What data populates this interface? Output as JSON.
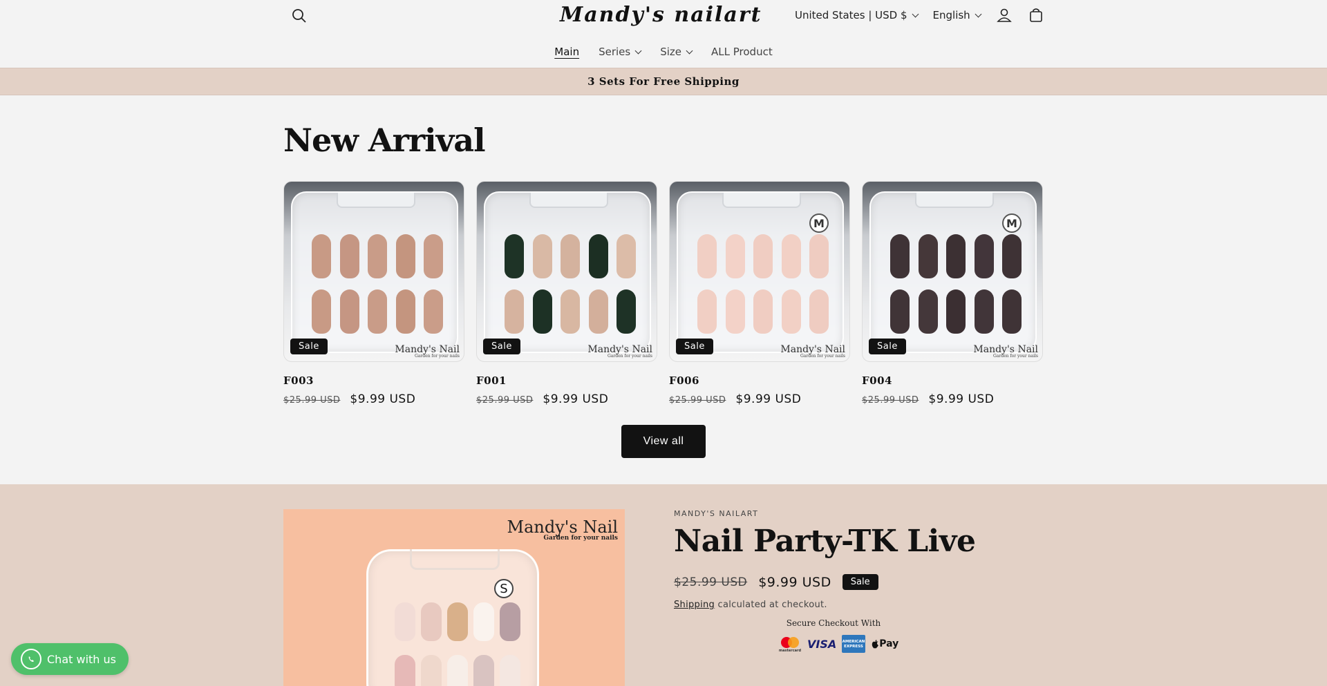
{
  "header": {
    "logo": "Mandy's nailart",
    "currency": "United States | USD $",
    "language": "English"
  },
  "nav": {
    "items": [
      {
        "label": "Main"
      },
      {
        "label": "Series"
      },
      {
        "label": "Size"
      },
      {
        "label": "ALL Product"
      }
    ]
  },
  "announcement": "3 Sets For Free Shipping",
  "new_arrival": {
    "title": "New Arrival",
    "products": [
      {
        "name": "F003",
        "old_price": "$25.99 USD",
        "price": "$9.99 USD",
        "badge": "Sale",
        "size_badge": "",
        "watermark": "Mandy's Nail",
        "watermark_sub": "Garden for your nails"
      },
      {
        "name": "F001",
        "old_price": "$25.99 USD",
        "price": "$9.99 USD",
        "badge": "Sale",
        "size_badge": "",
        "watermark": "Mandy's Nail",
        "watermark_sub": "Garden for your nails"
      },
      {
        "name": "F006",
        "old_price": "$25.99 USD",
        "price": "$9.99 USD",
        "badge": "Sale",
        "size_badge": "M",
        "watermark": "Mandy's Nail",
        "watermark_sub": "Garden for your nails"
      },
      {
        "name": "F004",
        "old_price": "$25.99 USD",
        "price": "$9.99 USD",
        "badge": "Sale",
        "size_badge": "M",
        "watermark": "Mandy's Nail",
        "watermark_sub": "Garden for your nails"
      }
    ],
    "view_all": "View all"
  },
  "featured": {
    "vendor": "MANDY'S NAILART",
    "title": "Nail Party-TK Live",
    "old_price": "$25.99 USD",
    "price": "$9.99 USD",
    "badge": "Sale",
    "shipping_link": "Shipping",
    "shipping_text": " calculated at checkout.",
    "secure": "Secure Checkout With",
    "image_logo": "Mandy's Nail",
    "image_logo_sub": "Garden for your nails",
    "size_badge": "S",
    "payment_methods": [
      "mastercard",
      "VISA",
      "AMERICAN EXPRESS",
      "Pay"
    ]
  },
  "chat": {
    "label": "Chat with us"
  }
}
